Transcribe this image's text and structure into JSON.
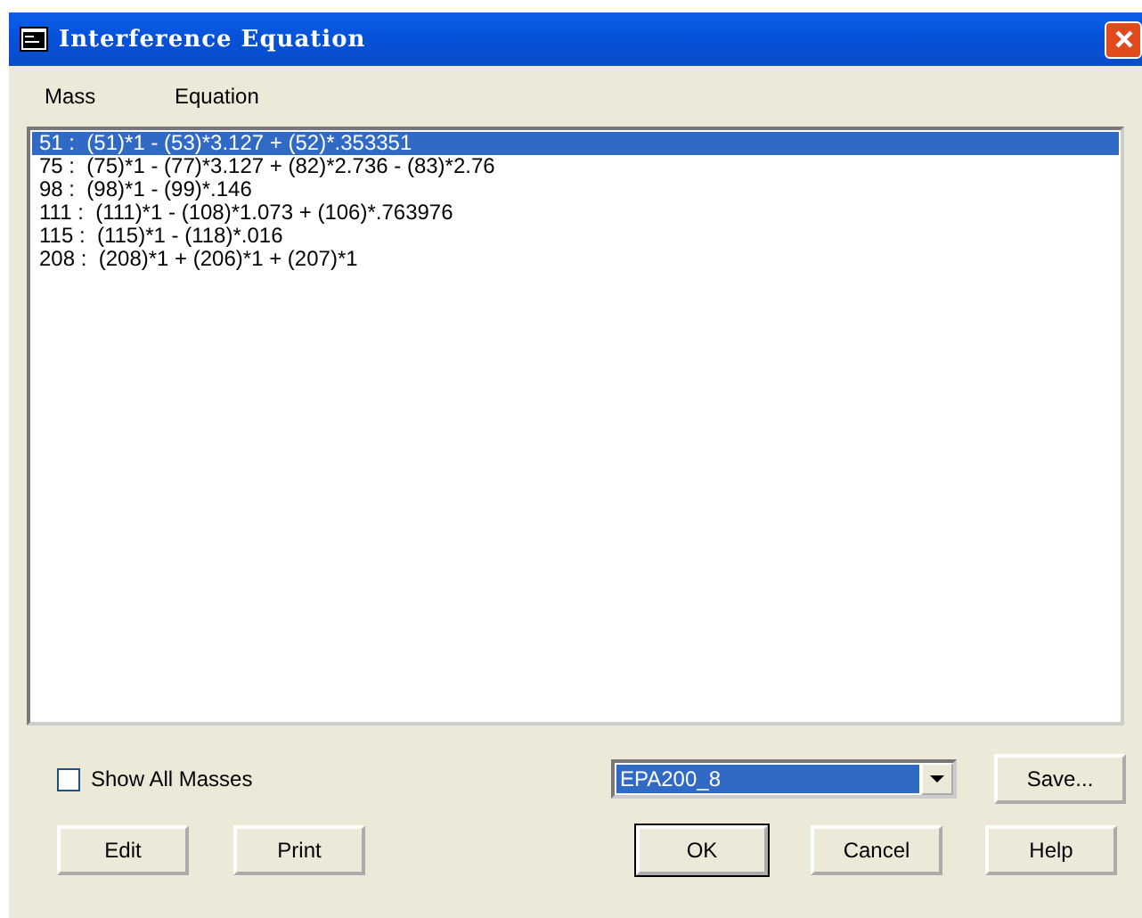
{
  "window": {
    "title": "Interference Equation"
  },
  "columns": [
    "Mass",
    "Equation"
  ],
  "rows": [
    {
      "mass": "51 :",
      "equation": "(51)*1 - (53)*3.127 + (52)*.353351",
      "selected": true
    },
    {
      "mass": "75 :",
      "equation": "(75)*1 - (77)*3.127 + (82)*2.736 - (83)*2.76",
      "selected": false
    },
    {
      "mass": "98 :",
      "equation": "(98)*1 - (99)*.146",
      "selected": false
    },
    {
      "mass": "111 :",
      "equation": "(111)*1 - (108)*1.073 + (106)*.763976",
      "selected": false
    },
    {
      "mass": "115 :",
      "equation": "(115)*1 - (118)*.016",
      "selected": false
    },
    {
      "mass": "208 :",
      "equation": "(208)*1 + (206)*1 + (207)*1",
      "selected": false
    }
  ],
  "show_all_masses": {
    "label": "Show All Masses",
    "checked": false
  },
  "method": {
    "value": "EPA200_8"
  },
  "save_button": {
    "label": "Save..."
  },
  "buttons": [
    {
      "label": "Edit",
      "kind": "normal"
    },
    {
      "label": "Print",
      "kind": "normal"
    },
    {
      "label": "OK",
      "kind": "default"
    },
    {
      "label": "Cancel",
      "kind": "normal"
    },
    {
      "label": "Help",
      "kind": "normal"
    }
  ]
}
